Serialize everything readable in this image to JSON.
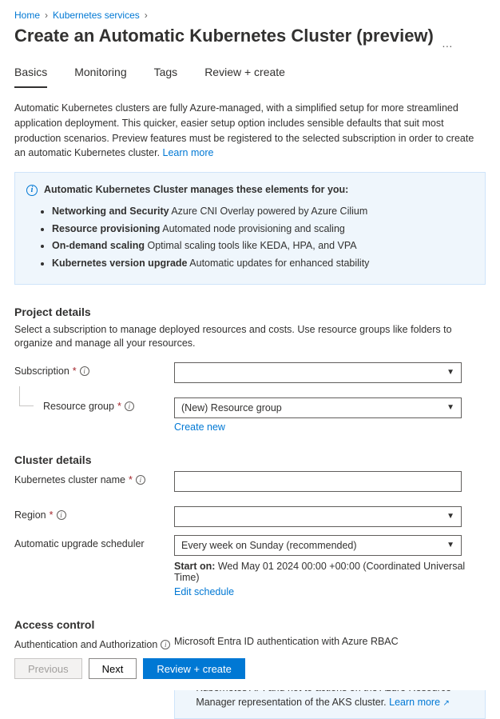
{
  "breadcrumb": {
    "home": "Home",
    "k8s": "Kubernetes services"
  },
  "title": "Create an Automatic Kubernetes Cluster (preview)",
  "tabs": {
    "basics": "Basics",
    "monitoring": "Monitoring",
    "tags": "Tags",
    "review": "Review + create"
  },
  "intro": {
    "text": "Automatic Kubernetes clusters are fully Azure-managed, with a simplified setup for more streamlined application deployment. This quicker, easier setup option includes sensible defaults that suit most production scenarios. Preview features must be registered to the selected subscription in order to create an automatic Kubernetes cluster. ",
    "learn": "Learn more"
  },
  "managed_box": {
    "heading": "Automatic Kubernetes Cluster manages these elements for you:",
    "items": [
      {
        "b": "Networking and Security",
        "rest": " Azure CNI Overlay powered by Azure Cilium"
      },
      {
        "b": "Resource provisioning",
        "rest": " Automated node provisioning and scaling"
      },
      {
        "b": "On-demand scaling",
        "rest": " Optimal scaling tools like KEDA, HPA, and VPA"
      },
      {
        "b": "Kubernetes version upgrade",
        "rest": " Automatic updates for enhanced stability"
      }
    ]
  },
  "project": {
    "title": "Project details",
    "desc": "Select a subscription to manage deployed resources and costs. Use resource groups like folders to organize and manage all your resources.",
    "subscription_label": "Subscription",
    "subscription_value": "",
    "rg_label": "Resource group",
    "rg_value": "(New) Resource group",
    "create_new": "Create new"
  },
  "cluster": {
    "title": "Cluster details",
    "name_label": "Kubernetes cluster name",
    "name_value": "",
    "region_label": "Region",
    "region_value": "",
    "sched_label": "Automatic upgrade scheduler",
    "sched_value": "Every week on Sunday (recommended)",
    "start_label": "Start on:",
    "start_value": " Wed May 01 2024 00:00 +00:00 (Coordinated Universal Time)",
    "edit_schedule": "Edit schedule"
  },
  "access": {
    "title": "Access control",
    "auth_label": "Authentication and Authorization",
    "auth_value": "Microsoft Entra ID authentication with Azure RBAC",
    "rbac_text": "This RBAC configuration only applies to data actions on the Kubernetes API and not to actions on the Azure Resource Manager representation of the AKS cluster.  ",
    "rbac_learn": "Learn more"
  },
  "footer": {
    "previous": "Previous",
    "next": "Next",
    "review": "Review + create"
  }
}
